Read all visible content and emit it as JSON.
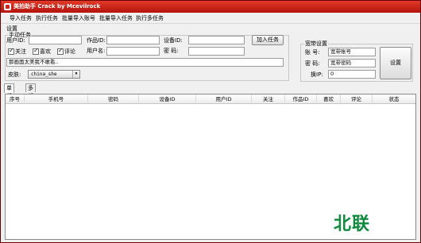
{
  "window": {
    "title": "美拍助手 Crack by Mcevilrock"
  },
  "menu": [
    "导入任务",
    "执行任务",
    "批量导入账号",
    "批量导入任务",
    "执行多任务"
  ],
  "settings": {
    "section_label": "设置",
    "manual_task_label": "手动任务",
    "user_id_label": "用户ID:",
    "user_id_value": "",
    "work_id_label": "作品ID:",
    "work_id_value": "",
    "device_id_label": "设备ID:",
    "device_id_value": "",
    "add_task_button": "加入任务",
    "username_label": "用户名:",
    "username_value": "",
    "password_label": "密  码:",
    "password_value": "",
    "checkboxes": [
      {
        "label": "关注",
        "checked": true
      },
      {
        "label": "喜欢",
        "checked": true
      },
      {
        "label": "评论",
        "checked": true
      }
    ],
    "comment_value": "那画面太美我不敢看..",
    "skin_label": "皮肤:",
    "skin_value": "china_she"
  },
  "broadband": {
    "group_label": "宽带设置",
    "account_label": "账  号:",
    "account_value": "宽带账号",
    "password_label": "密  码:",
    "password_value": "宽带密码",
    "ip_label": "换IP:",
    "ip_value": "0",
    "settings_button": "设置"
  },
  "tabs": [
    "单任务",
    "多任务"
  ],
  "table": {
    "columns": [
      "序号",
      "手机号",
      "密码",
      "设备ID",
      "用户ID",
      "关注",
      "作品ID",
      "喜欢",
      "评论",
      "状态"
    ],
    "rows": []
  },
  "watermark": "北联"
}
